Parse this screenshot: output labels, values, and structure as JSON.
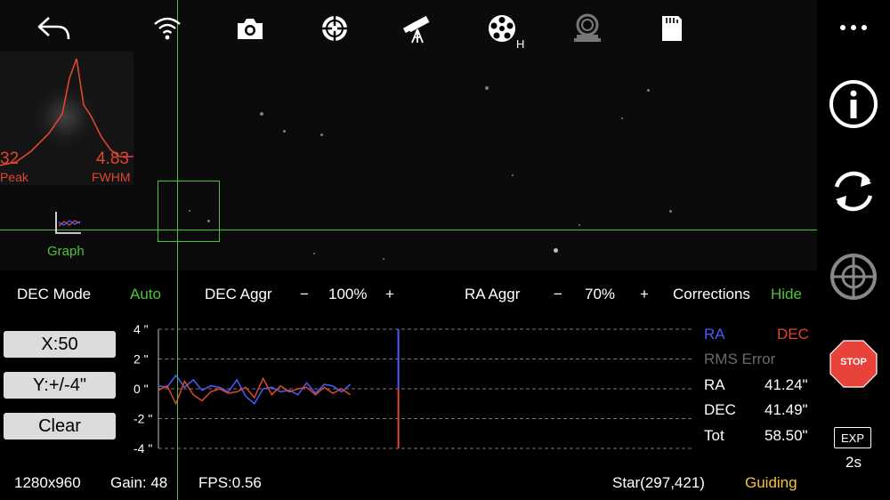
{
  "toolbar": {
    "icons": [
      "back-arrow-icon",
      "wifi-icon",
      "camera-icon",
      "crosshair-icon",
      "telescope-icon",
      "filter-wheel-icon",
      "focuser-icon",
      "sd-card-icon"
    ],
    "filter_badge": "H"
  },
  "star_profile": {
    "peak_value": "32",
    "peak_label": "Peak",
    "fwhm_value": "4.83",
    "fwhm_label": "FWHM"
  },
  "graph_toggle": {
    "label": "Graph"
  },
  "controls": {
    "dec_mode_label": "DEC Mode",
    "dec_mode_value": "Auto",
    "dec_aggr_label": "DEC Aggr",
    "dec_aggr_minus": "−",
    "dec_aggr_value": "100%",
    "dec_aggr_plus": "+",
    "ra_aggr_label": "RA Aggr",
    "ra_aggr_minus": "−",
    "ra_aggr_value": "70%",
    "ra_aggr_plus": "+",
    "corrections_label": "Corrections",
    "corrections_value": "Hide"
  },
  "graph_buttons": {
    "x_scale": "X:50",
    "y_scale": "Y:+/-4\"",
    "clear": "Clear"
  },
  "chart_data": {
    "type": "line",
    "y_ticks": [
      "4 \"",
      "2 \"",
      "0 \"",
      "-2 \"",
      "-4 \""
    ],
    "ylim": [
      -4,
      4
    ],
    "grid": true,
    "series": [
      {
        "name": "RA",
        "color": "#4a5cff",
        "values": [
          0.2,
          0.1,
          0.9,
          0.1,
          0.6,
          -0.1,
          0.2,
          0.1,
          -0.2,
          0.6,
          -0.5,
          -1.0,
          0.0,
          0.1,
          -0.2,
          -0.1,
          -0.4,
          0.4,
          -0.3,
          0.3,
          0.2,
          -0.2,
          0.3
        ]
      },
      {
        "name": "DEC",
        "color": "#e0452f",
        "values": [
          -0.1,
          0.2,
          -1.0,
          0.5,
          -0.4,
          -0.8,
          -0.2,
          0.0,
          -0.3,
          -0.2,
          0.1,
          -0.6,
          0.7,
          -0.4,
          0.2,
          -0.2,
          0.0,
          0.1,
          -0.4,
          0.1,
          -0.3,
          0.0,
          -0.4
        ]
      }
    ]
  },
  "rms": {
    "ra_legend": "RA",
    "dec_legend": "DEC",
    "title": "RMS Error",
    "rows": [
      {
        "label": "RA",
        "value": "41.24\""
      },
      {
        "label": "DEC",
        "value": "41.49\""
      },
      {
        "label": "Tot",
        "value": "58.50\""
      }
    ]
  },
  "status": {
    "resolution": "1280x960",
    "gain": "Gain: 48",
    "fps": "FPS:0.56",
    "star": "Star(297,421)",
    "state": "Guiding"
  },
  "sidebar": {
    "menu_icon": "more-icon",
    "stop_label": "STOP",
    "exp_label": "EXP",
    "exp_value": "2s"
  },
  "colors": {
    "accent_green": "#4fc23b",
    "guiding_yellow": "#f4c434",
    "ra_blue": "#4a5cff",
    "dec_red": "#e0452f",
    "stop_red": "#e8423a"
  }
}
